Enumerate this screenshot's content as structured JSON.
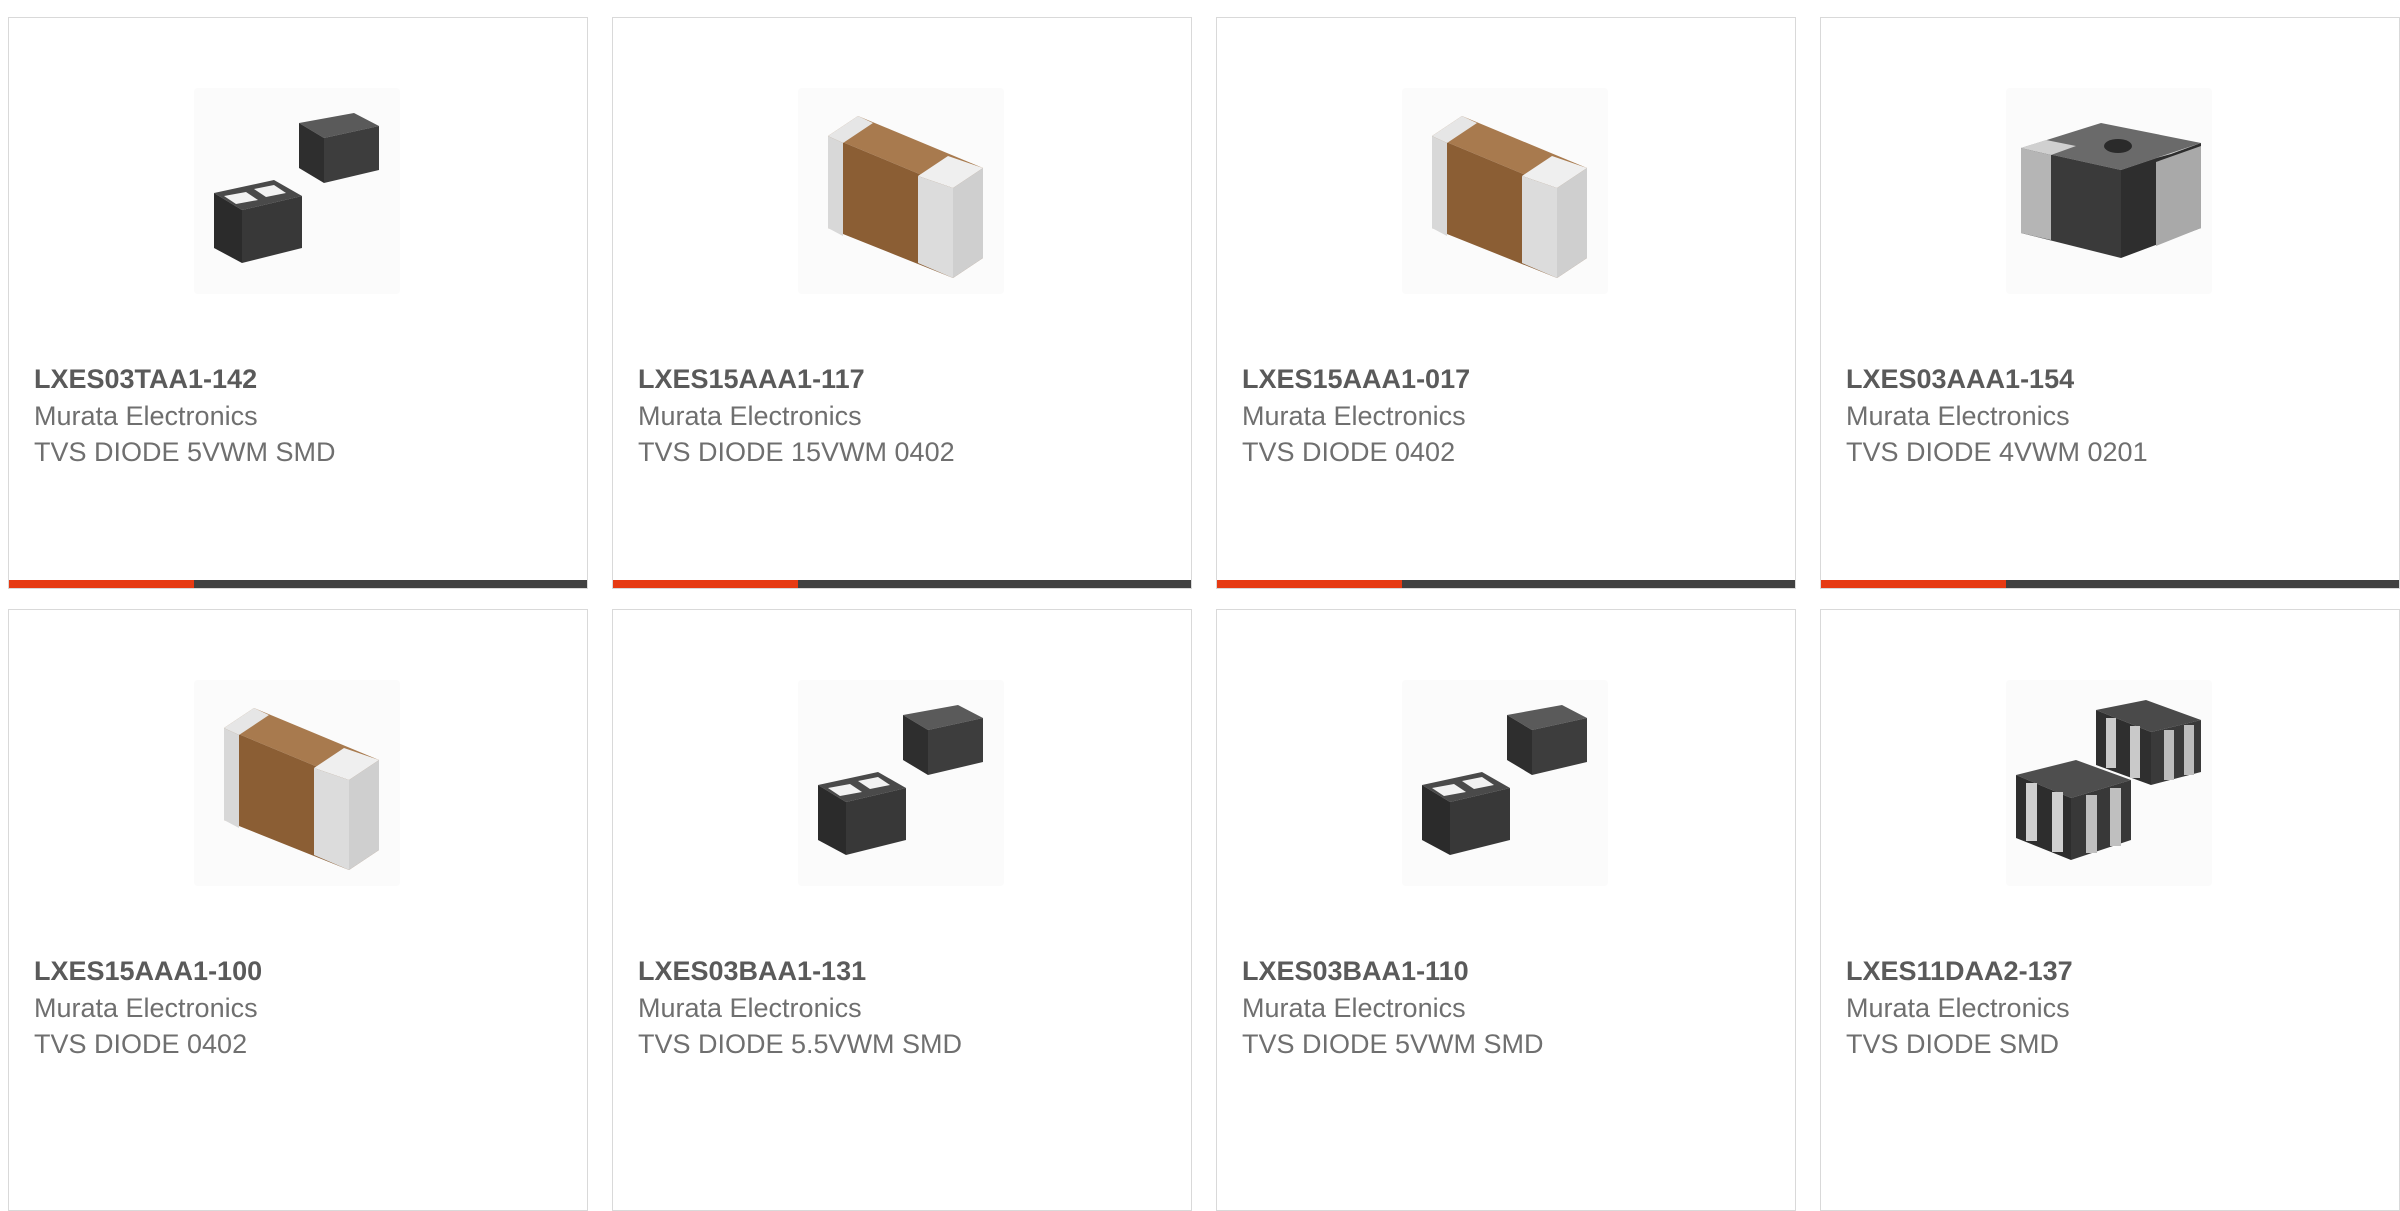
{
  "colors": {
    "accent": "#e63a13",
    "bar_track": "#404040",
    "part_number": "#5a5a5a",
    "secondary_text": "#6f6f6f",
    "card_border": "#d9d9d9"
  },
  "cards": [
    {
      "part_number": "LXES03TAA1-142",
      "manufacturer": "Murata Electronics",
      "description": "TVS DIODE 5VWM SMD",
      "image": "two-black-chip-icon",
      "bar_fill": 0.32
    },
    {
      "part_number": "LXES15AAA1-117",
      "manufacturer": "Murata Electronics",
      "description": "TVS DIODE 15VWM 0402",
      "image": "brown-chip-icon",
      "bar_fill": 0.32
    },
    {
      "part_number": "LXES15AAA1-017",
      "manufacturer": "Murata Electronics",
      "description": "TVS DIODE 0402",
      "image": "brown-chip-icon",
      "bar_fill": 0.32
    },
    {
      "part_number": "LXES03AAA1-154",
      "manufacturer": "Murata Electronics",
      "description": "TVS DIODE 4VWM 0201",
      "image": "black-gray-chip-icon",
      "bar_fill": 0.32
    },
    {
      "part_number": "LXES15AAA1-100",
      "manufacturer": "Murata Electronics",
      "description": "TVS DIODE 0402",
      "image": "brown-chip-icon"
    },
    {
      "part_number": "LXES03BAA1-131",
      "manufacturer": "Murata Electronics",
      "description": "TVS DIODE 5.5VWM SMD",
      "image": "two-black-chip-icon"
    },
    {
      "part_number": "LXES03BAA1-110",
      "manufacturer": "Murata Electronics",
      "description": "TVS DIODE 5VWM SMD",
      "image": "two-black-chip-icon"
    },
    {
      "part_number": "LXES11DAA2-137",
      "manufacturer": "Murata Electronics",
      "description": "TVS DIODE SMD",
      "image": "array-chip-icon"
    }
  ]
}
